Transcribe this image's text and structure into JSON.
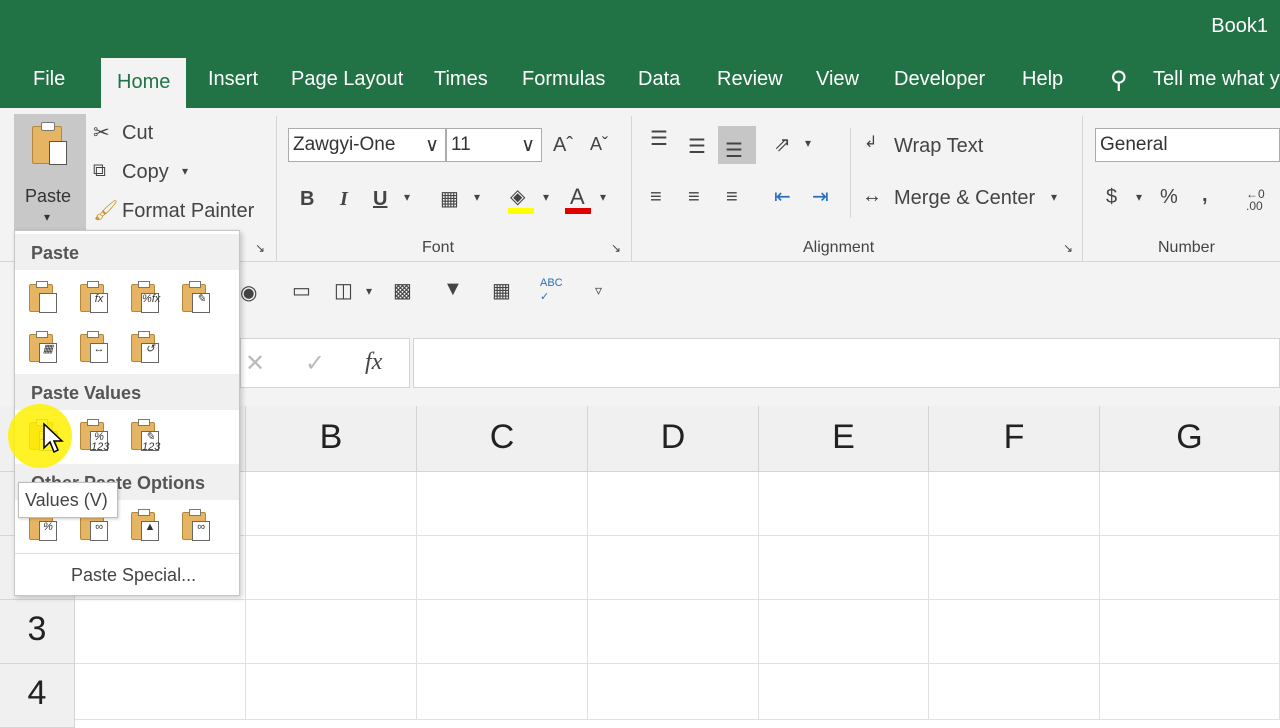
{
  "title": "Book1",
  "tabs": [
    "File",
    "Home",
    "Insert",
    "Page Layout",
    "Times",
    "Formulas",
    "Data",
    "Review",
    "View",
    "Developer",
    "Help"
  ],
  "tell_me": "Tell me what y",
  "clipboard": {
    "paste": "Paste",
    "cut": "Cut",
    "copy": "Copy",
    "format_painter": "Format Painter"
  },
  "font": {
    "name": "Zawgyi-One",
    "size": "11",
    "group_label": "Font",
    "bold": "B",
    "italic": "I",
    "underline": "U",
    "font_color": "A"
  },
  "alignment": {
    "wrap_text": "Wrap Text",
    "merge_center": "Merge & Center",
    "group_label": "Alignment"
  },
  "number": {
    "format": "General",
    "group_label": "Number",
    "currency": "$",
    "percent": "%",
    "comma": ","
  },
  "formula_fx": "fx",
  "columns": [
    "B",
    "C",
    "D",
    "E",
    "F",
    "G"
  ],
  "rows": [
    "3",
    "4"
  ],
  "paste_menu": {
    "paste_header": "Paste",
    "values_header": "Paste Values",
    "other_header": "Other Paste Options",
    "paste_special": "Paste Special..."
  },
  "tooltip": "Values (V)",
  "colors": {
    "excel_green": "#217346",
    "ribbon_bg": "#f3f3f3",
    "highlight": "#fff000"
  }
}
